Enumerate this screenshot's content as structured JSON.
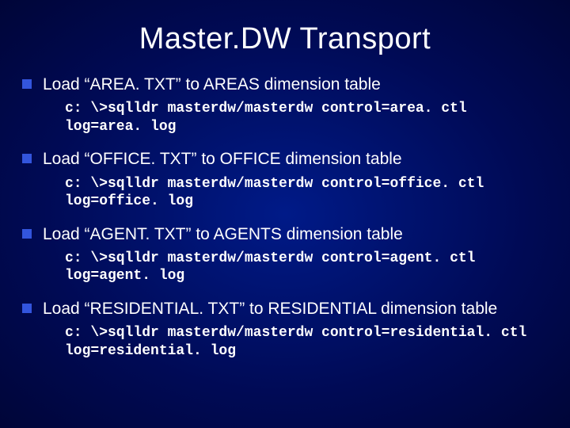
{
  "title": "Master.DW Transport",
  "items": [
    {
      "point": "Load “AREA. TXT” to AREAS dimension table",
      "cmd": "c: \\>sqlldr masterdw/masterdw control=area. ctl\nlog=area. log"
    },
    {
      "point": "Load “OFFICE. TXT” to OFFICE dimension table",
      "cmd": "c: \\>sqlldr masterdw/masterdw control=office. ctl\nlog=office. log"
    },
    {
      "point": "Load “AGENT. TXT” to AGENTS dimension table",
      "cmd": "c: \\>sqlldr masterdw/masterdw control=agent. ctl\nlog=agent. log"
    },
    {
      "point": "Load “RESIDENTIAL. TXT” to RESIDENTIAL dimension table",
      "cmd": "c: \\>sqlldr masterdw/masterdw control=residential. ctl\nlog=residential. log"
    }
  ]
}
